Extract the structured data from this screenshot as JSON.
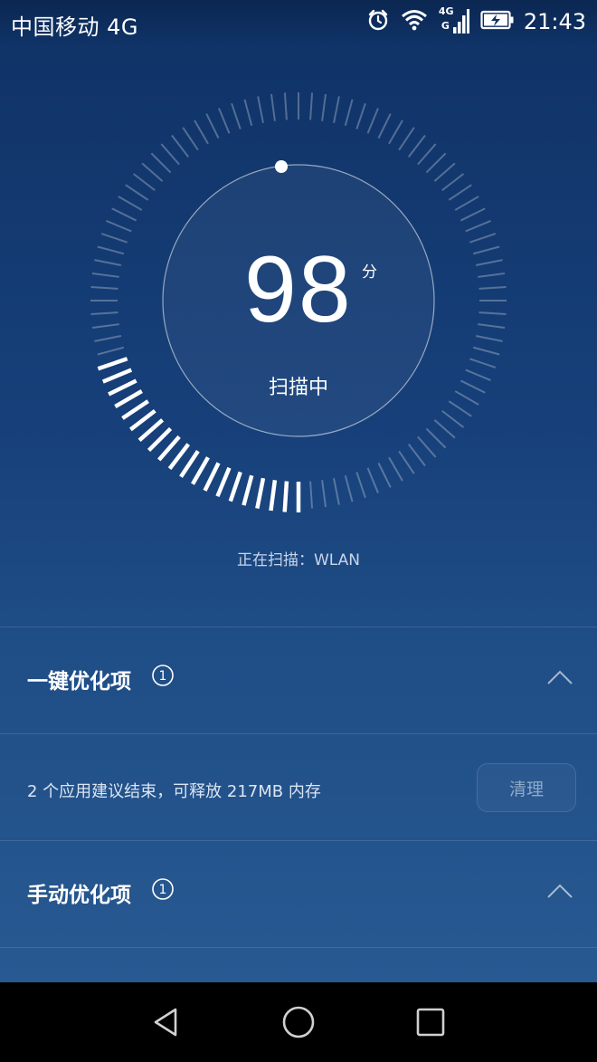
{
  "status_bar": {
    "carrier": "中国移动 4G",
    "network_badge_top": "4G",
    "network_badge_bottom": "G",
    "time": "21:43",
    "icons": [
      "alarm-icon",
      "wifi-icon",
      "signal-icon",
      "battery-charging-icon"
    ]
  },
  "gauge": {
    "score": "98",
    "unit": "分",
    "status": "扫描中",
    "progress_fraction": 0.21,
    "scanning_label": "正在扫描：WLAN"
  },
  "sections": {
    "one_click": {
      "title": "一键优化项",
      "info_badge": "1",
      "expanded": true,
      "row_text": "2 个应用建议结束，可释放 217MB 内存",
      "button": "清理"
    },
    "manual": {
      "title": "手动优化项",
      "info_badge": "1",
      "expanded": true
    }
  },
  "nav": {
    "icons": [
      "back-icon",
      "home-icon",
      "recents-icon"
    ]
  },
  "colors": {
    "background_top": "#0f3266",
    "background_bottom": "#2a5c94",
    "text_primary": "#ffffff",
    "text_muted": "#c8d6ea",
    "button_text": "#8fa9c8"
  }
}
